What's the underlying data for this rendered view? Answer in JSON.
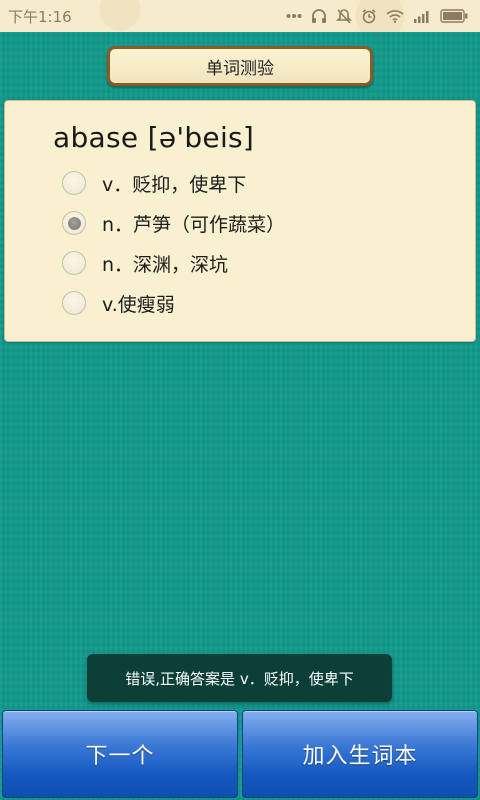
{
  "status_bar": {
    "time": "下午1:16",
    "icons": [
      "more-dots-icon",
      "headphones-icon",
      "mute-icon",
      "alarm-icon",
      "wifi-icon",
      "signal-icon",
      "battery-icon"
    ]
  },
  "header": {
    "title": "单词测验"
  },
  "quiz": {
    "word": "abase [ə'beis]",
    "options": [
      {
        "label": "v．贬抑，使卑下",
        "selected": false
      },
      {
        "label": "n．芦笋（可作蔬菜）",
        "selected": true
      },
      {
        "label": "n．深渊，深坑",
        "selected": false
      },
      {
        "label": "v.使瘦弱",
        "selected": false
      }
    ]
  },
  "toast": {
    "message": "错误,正确答案是 v．贬抑，使卑下"
  },
  "buttons": {
    "next_label": "下一个",
    "add_label": "加入生词本"
  },
  "colors": {
    "background": "#119a8c",
    "card": "#f8f0cf",
    "button": "#1458c0",
    "toast": "#0c3f38"
  }
}
